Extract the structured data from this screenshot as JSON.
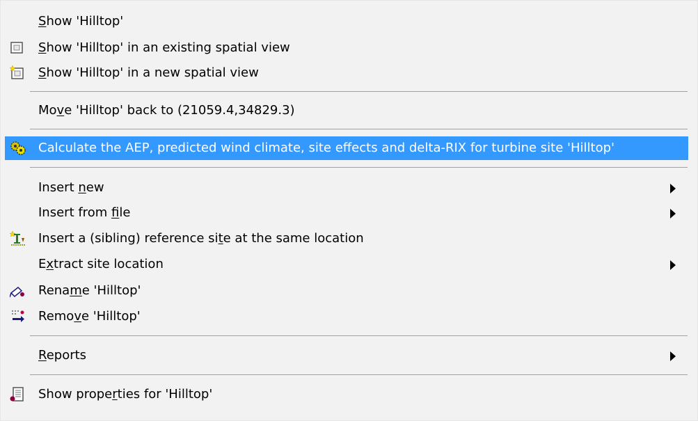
{
  "menu": {
    "items": [
      {
        "before": "",
        "key": "S",
        "after": "how 'Hilltop'",
        "icon": "none",
        "submenu": false
      },
      {
        "before": "",
        "key": "S",
        "after": "how 'Hilltop' in an existing spatial view",
        "icon": "spatial-view-icon",
        "submenu": false
      },
      {
        "before": "",
        "key": "S",
        "after": "how 'Hilltop' in a new spatial view",
        "icon": "new-spatial-view-icon",
        "submenu": false
      },
      {
        "before": "Mo",
        "key": "v",
        "after": "e 'Hilltop' back to (21059.4,34829.3)",
        "icon": "none",
        "submenu": false
      },
      {
        "before": "Calculate the AEP, predicted wind climate, site effects and delta-RIX for turbine site 'Hilltop'",
        "key": "",
        "after": "",
        "icon": "calculate-gears-icon",
        "submenu": false,
        "selected": true
      },
      {
        "before": "Insert ",
        "key": "n",
        "after": "ew",
        "icon": "none",
        "submenu": true
      },
      {
        "before": "Insert from ",
        "key": "f",
        "after": "ile",
        "icon": "none",
        "submenu": true
      },
      {
        "before": "Insert a (sibling) reference si",
        "key": "t",
        "after": "e at the same location",
        "icon": "insert-reference-site-icon",
        "submenu": false
      },
      {
        "before": "E",
        "key": "x",
        "after": "tract site location",
        "icon": "none",
        "submenu": true
      },
      {
        "before": "Rena",
        "key": "m",
        "after": "e 'Hilltop'",
        "icon": "rename-icon",
        "submenu": false
      },
      {
        "before": "Remo",
        "key": "v",
        "after": "e 'Hilltop'",
        "icon": "remove-icon",
        "submenu": false
      },
      {
        "before": "",
        "key": "R",
        "after": "eports",
        "icon": "none",
        "submenu": true
      },
      {
        "before": "Show prope",
        "key": "r",
        "after": "ties for 'Hilltop'",
        "icon": "properties-icon",
        "submenu": false
      }
    ]
  },
  "colors": {
    "menu_background": "#f2f2f2",
    "selection": "#3399ff",
    "selected_text": "#ffffff",
    "separator": "#a0a0a0"
  }
}
